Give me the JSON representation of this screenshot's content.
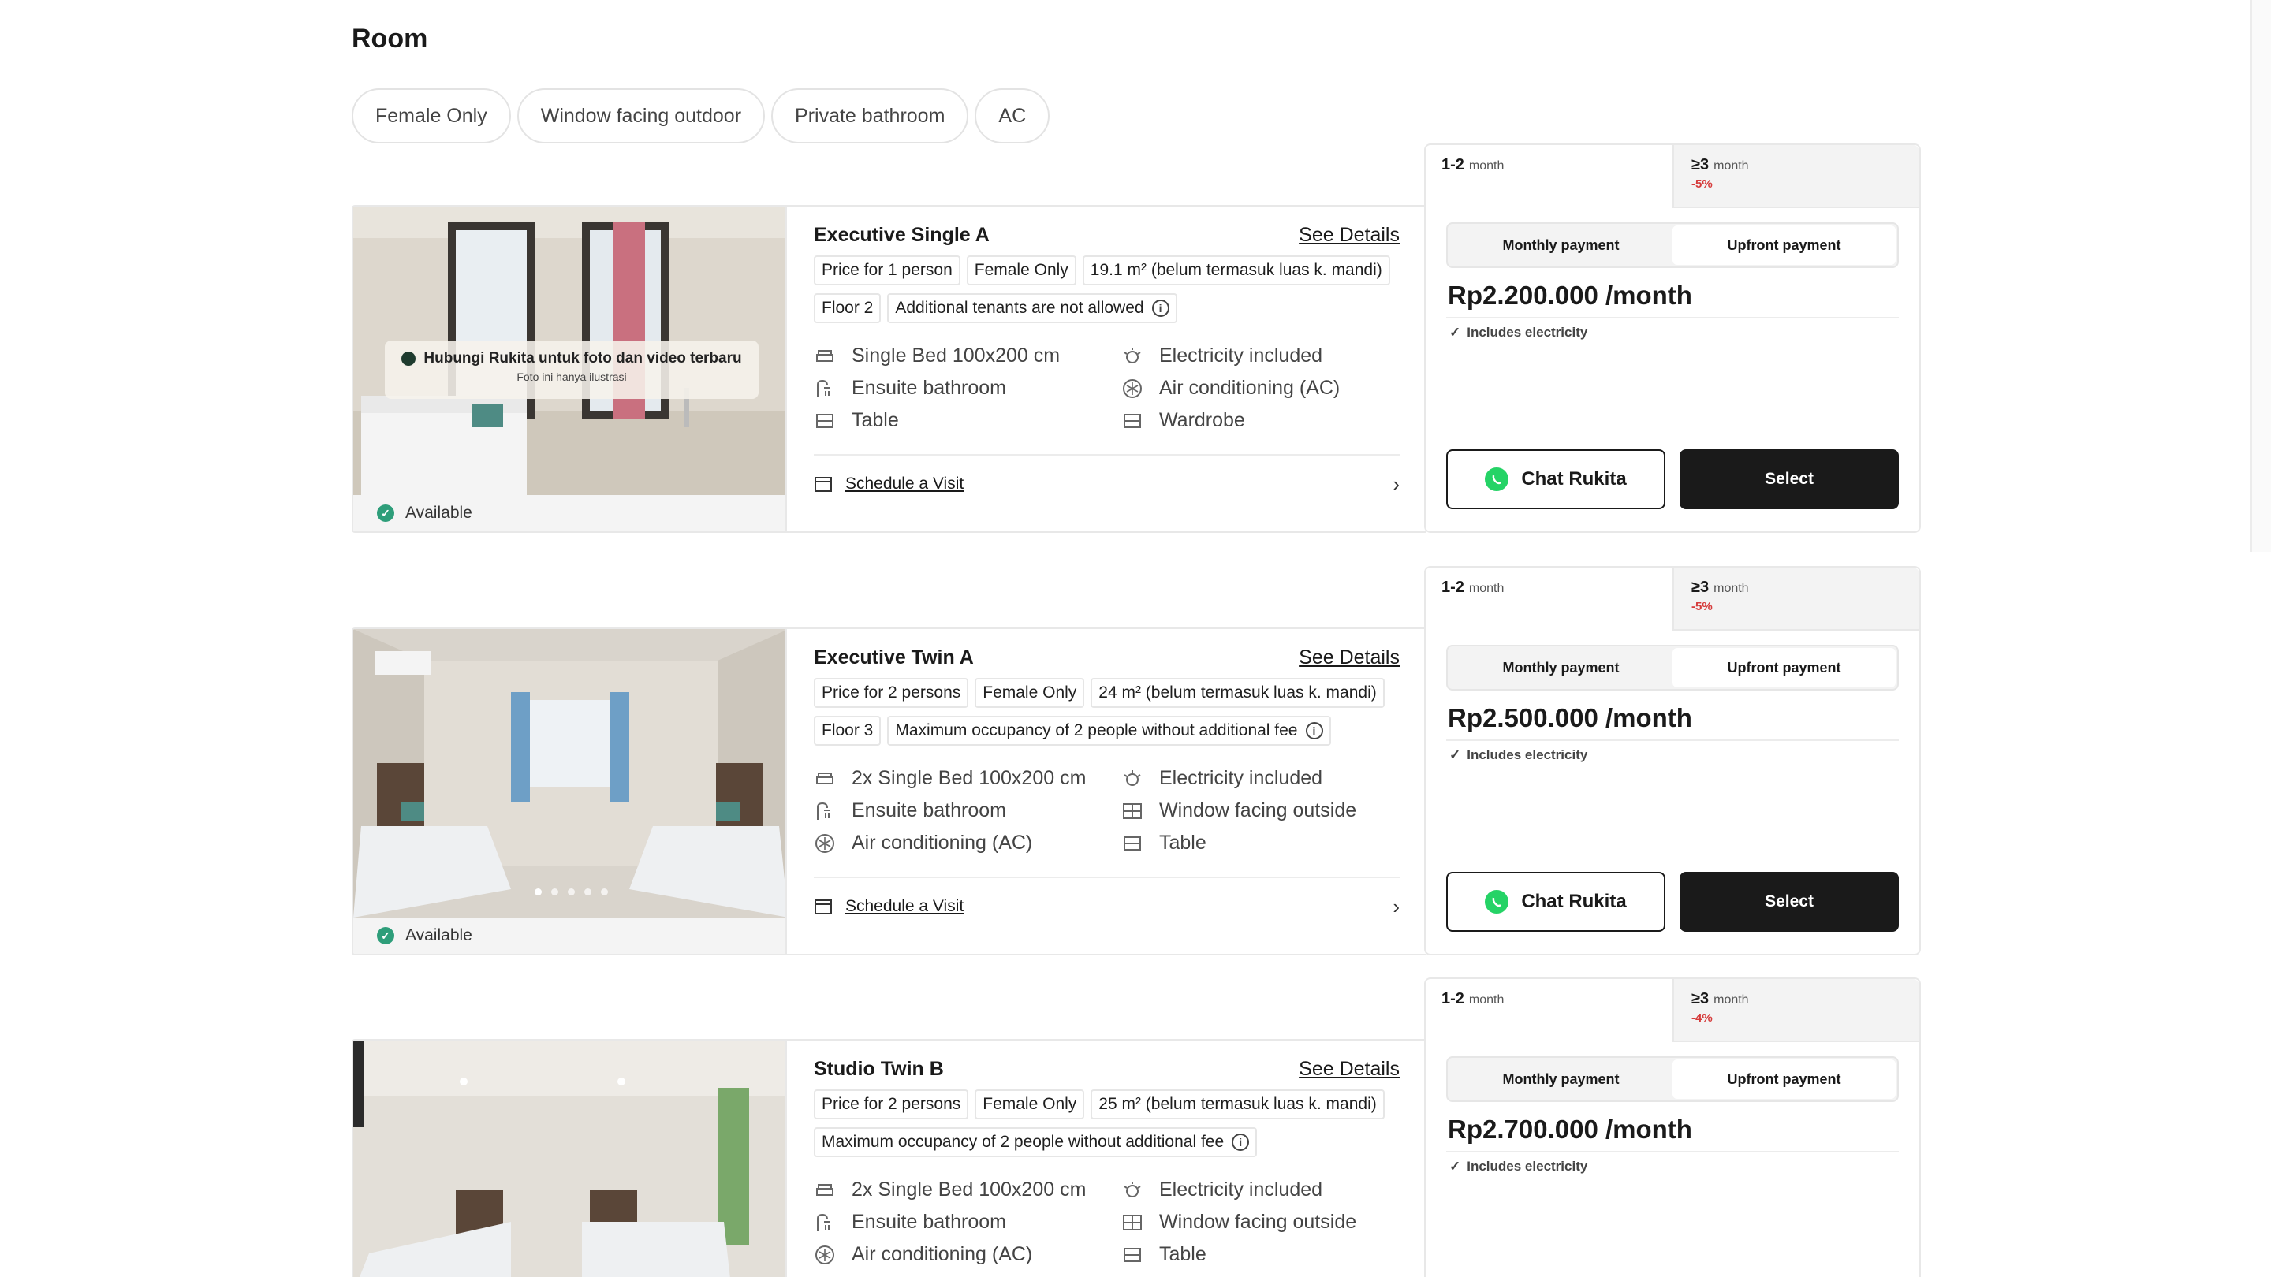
{
  "page": {
    "title": "Room"
  },
  "filters": [
    "Female Only",
    "Window facing outdoor",
    "Private bathroom",
    "AC"
  ],
  "rooms": [
    {
      "name": "Executive Single A",
      "see_details": "See Details",
      "tags_row1": [
        "Price for 1 person",
        "Female Only",
        "19.1 m² (belum termasuk luas k. mandi)"
      ],
      "tags_row2": [
        "Floor 2",
        "Additional tenants are not allowed"
      ],
      "facilities": [
        {
          "icon": "bed-icon",
          "label": "Single Bed 100x200 cm"
        },
        {
          "icon": "electricity-icon",
          "label": "Electricity included"
        },
        {
          "icon": "shower-icon",
          "label": "Ensuite bathroom"
        },
        {
          "icon": "ac-icon",
          "label": "Air conditioning (AC)"
        },
        {
          "icon": "table-icon",
          "label": "Table"
        },
        {
          "icon": "wardrobe-icon",
          "label": "Wardrobe"
        }
      ],
      "schedule_visit": "Schedule a Visit",
      "availability": "Available",
      "photo_note_title": "Hubungi Rukita untuk foto dan video terbaru",
      "photo_note_sub": "Foto ini hanya ilustrasi",
      "duration_tabs": [
        {
          "value": "1-2",
          "unit": "month",
          "discount": ""
        },
        {
          "value": "≥3",
          "unit": "month",
          "discount": "-5%"
        }
      ],
      "payment_options": [
        "Monthly payment",
        "Upfront payment"
      ],
      "price": "Rp2.200.000 /month",
      "includes": "Includes electricity",
      "chat_label": "Chat Rukita",
      "select_label": "Select"
    },
    {
      "name": "Executive Twin A",
      "see_details": "See Details",
      "tags_row1": [
        "Price for 2 persons",
        "Female Only",
        "24 m² (belum termasuk luas k. mandi)"
      ],
      "tags_row2": [
        "Floor 3",
        "Maximum occupancy of 2 people without additional fee"
      ],
      "facilities": [
        {
          "icon": "bed-icon",
          "label": "2x Single Bed 100x200 cm"
        },
        {
          "icon": "electricity-icon",
          "label": "Electricity included"
        },
        {
          "icon": "shower-icon",
          "label": "Ensuite bathroom"
        },
        {
          "icon": "window-icon",
          "label": "Window facing outside"
        },
        {
          "icon": "ac-icon",
          "label": "Air conditioning (AC)"
        },
        {
          "icon": "table-icon",
          "label": "Table"
        }
      ],
      "schedule_visit": "Schedule a Visit",
      "availability": "Available",
      "duration_tabs": [
        {
          "value": "1-2",
          "unit": "month",
          "discount": ""
        },
        {
          "value": "≥3",
          "unit": "month",
          "discount": "-5%"
        }
      ],
      "payment_options": [
        "Monthly payment",
        "Upfront payment"
      ],
      "price": "Rp2.500.000 /month",
      "includes": "Includes electricity",
      "chat_label": "Chat Rukita",
      "select_label": "Select"
    },
    {
      "name": "Studio Twin B",
      "see_details": "See Details",
      "tags_row1": [
        "Price for 2 persons",
        "Female Only",
        "25 m² (belum termasuk luas k. mandi)"
      ],
      "tags_row2": [
        "Maximum occupancy of 2 people without additional fee"
      ],
      "facilities": [
        {
          "icon": "bed-icon",
          "label": "2x Single Bed 100x200 cm"
        },
        {
          "icon": "electricity-icon",
          "label": "Electricity included"
        },
        {
          "icon": "shower-icon",
          "label": "Ensuite bathroom"
        },
        {
          "icon": "window-icon",
          "label": "Window facing outside"
        },
        {
          "icon": "ac-icon",
          "label": "Air conditioning (AC)"
        },
        {
          "icon": "table-icon",
          "label": "Table"
        }
      ],
      "duration_tabs": [
        {
          "value": "1-2",
          "unit": "month",
          "discount": ""
        },
        {
          "value": "≥3",
          "unit": "month",
          "discount": "-4%"
        }
      ],
      "payment_options": [
        "Monthly payment",
        "Upfront payment"
      ],
      "price": "Rp2.700.000 /month",
      "includes": "Includes electricity"
    }
  ],
  "colors": {
    "accent_dark": "#1a1a1a",
    "available_green": "#2e9e7a",
    "discount_red": "#d63b3b",
    "whatsapp_green": "#25d366"
  }
}
